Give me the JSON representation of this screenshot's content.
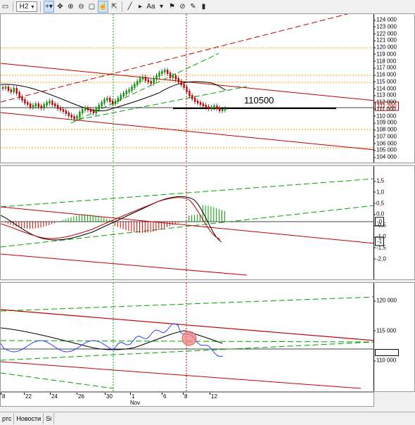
{
  "toolbar": {
    "timeframe": "H2",
    "text_tool": "Aa",
    "icons": [
      "page-icon",
      "crosshair-icon",
      "move-icon",
      "zoom-in-icon",
      "zoom-out-icon",
      "hand-icon",
      "cursor-icon",
      "line-icon",
      "arrow-icon",
      "text-icon",
      "flag-icon",
      "hide-icon",
      "delete-icon",
      "chart-icon"
    ]
  },
  "main_pane": {
    "price_ticks": [
      "124 000",
      "123 000",
      "122 000",
      "121 000",
      "120 000",
      "119 000",
      "118 000",
      "117 000",
      "116 000",
      "115 000",
      "114 000",
      "113 000",
      "112 000",
      "111 000",
      "110 000",
      "109 000",
      "108 000",
      "107 000",
      "106 000",
      "105 000",
      "104 000"
    ],
    "current_price": "111 290",
    "annotation": "110500"
  },
  "osc_pane": {
    "ticks": [
      "1,5",
      "1,0",
      "0,5",
      "0,0",
      "-0,5",
      "-1,0",
      "-1,5",
      "-2,0"
    ],
    "value_box": "-0",
    "value_box_2": "-1"
  },
  "ind_pane": {
    "ticks": [
      "120 000",
      "115 000",
      "110 000"
    ],
    "value_box": ""
  },
  "date_axis": {
    "labels": [
      "8",
      "22",
      "24",
      "26",
      "30",
      "1",
      "6",
      "8",
      "12"
    ],
    "month": "Nov"
  },
  "tabs": [
    "ртс",
    "Новости",
    "Si"
  ],
  "colors": {
    "up_bar": "#00a000",
    "down_bar": "#d00000",
    "trend_red": "#c00000",
    "trend_green": "#00a000",
    "level_orange": "#ff9900",
    "osc_blue": "#3040ff"
  }
}
